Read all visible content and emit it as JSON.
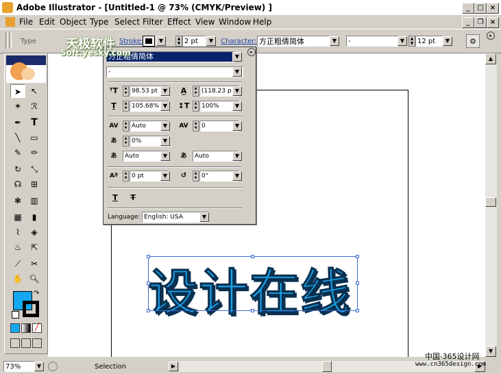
{
  "window": {
    "title": "Adobe Illustrator - [Untitled-1 @ 73% (CMYK/Preview) ]"
  },
  "menu": [
    "File",
    "Edit",
    "Object",
    "Type",
    "Select",
    "Filter",
    "Effect",
    "View",
    "Window",
    "Help"
  ],
  "control": {
    "type_label": "Type",
    "stroke_label": "Stroke:",
    "stroke_weight": "2 pt",
    "character_label": "Character:",
    "font_family": "方正粗倩简体",
    "font_style": "-",
    "font_size": "12 pt"
  },
  "panel": {
    "font_family": "方正粗倩简体",
    "font_style": "-",
    "font_size": "98.53 pt",
    "leading": "(118.23 p",
    "horizontal_scale": "105.68%",
    "vertical_scale": "100%",
    "kerning": "Auto",
    "tracking": "0",
    "tsume": "0%",
    "aki_left": "Auto",
    "aki_right": "Auto",
    "baseline_shift": "0 pt",
    "rotation": "0°",
    "language_label": "Language:",
    "language": "English: USA"
  },
  "art": {
    "text": "设计在线",
    "fill_color": "#1aa3e8",
    "fill_swatch": "#13a8f0"
  },
  "status": {
    "zoom": "73%",
    "mode": "Selection"
  },
  "watermark": {
    "top": "天极软件",
    "top_url": "Soft.yesky.com",
    "bottom": "中国·365设计网",
    "bottom_url": "www.cn365design.com"
  }
}
